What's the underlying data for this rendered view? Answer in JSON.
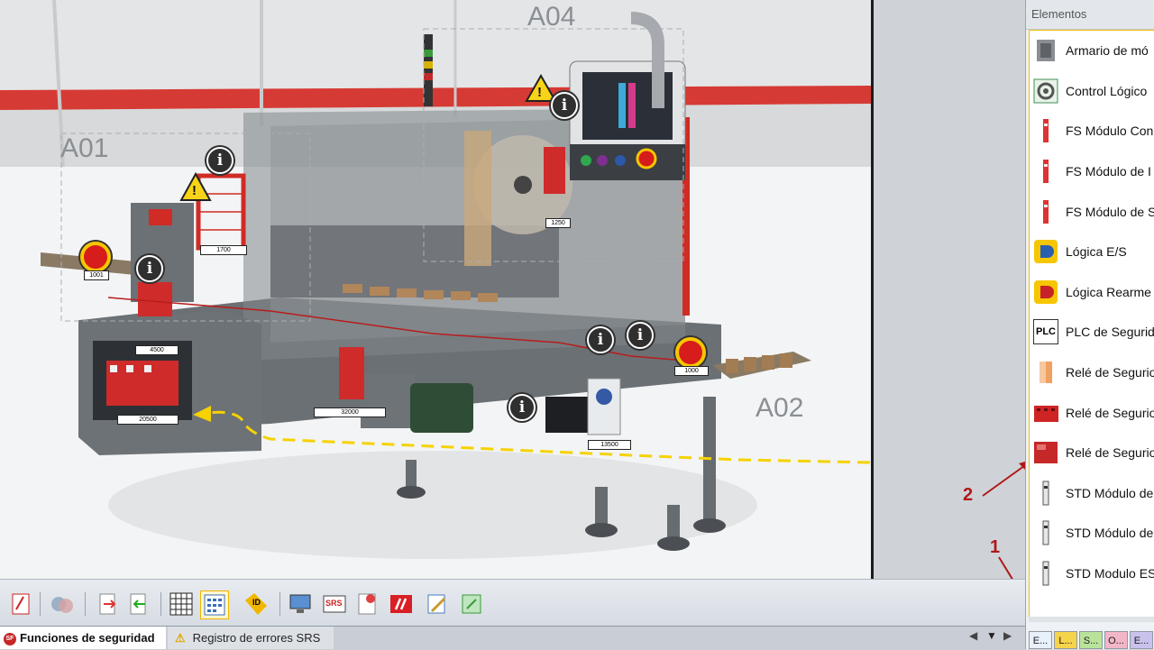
{
  "viewport": {
    "area_labels": {
      "a01": "A01",
      "a02": "A02",
      "a04": "A04"
    },
    "device_tags": {
      "t1001": "1001",
      "t1700": "1700",
      "t1250": "1250",
      "t4500": "4500",
      "t1000": "1000",
      "t20500": "20500",
      "t32000": "32000",
      "t13500": "13500"
    },
    "info_glyph": "i",
    "warning_glyph": "!"
  },
  "elements_panel": {
    "title": "Elementos",
    "items": [
      {
        "label": "Armario de mó",
        "icon": "cabinet-icon"
      },
      {
        "label": "Control Lógico",
        "icon": "gear-logic-icon"
      },
      {
        "label": "FS Módulo Con",
        "icon": "fs-module-icon"
      },
      {
        "label": "FS Módulo de I",
        "icon": "fs-module-icon"
      },
      {
        "label": "FS Módulo de S",
        "icon": "fs-module-icon"
      },
      {
        "label": "Lógica E/S",
        "icon": "logic-io-icon"
      },
      {
        "label": "Lógica Rearme",
        "icon": "logic-reset-icon"
      },
      {
        "label": "PLC de Segurid",
        "icon": "plc-icon"
      },
      {
        "label": "Relé de Segurio",
        "icon": "relay-orange-icon"
      },
      {
        "label": "Relé de Segurio",
        "icon": "relay-red-icon"
      },
      {
        "label": "Relé de Segurio",
        "icon": "relay-red-box-icon"
      },
      {
        "label": "STD Módulo de",
        "icon": "std-module-icon"
      },
      {
        "label": "STD Módulo de",
        "icon": "std-module-icon"
      },
      {
        "label": "STD Modulo ES",
        "icon": "std-module-icon"
      }
    ],
    "plc_icon_text": "PLC",
    "tabs": [
      {
        "label": "E...",
        "color": "#e8f0fb"
      },
      {
        "label": "L...",
        "color": "#f5d34a"
      },
      {
        "label": "S...",
        "color": "#b9e39a"
      },
      {
        "label": "O...",
        "color": "#f2b6c8"
      },
      {
        "label": "E...",
        "color": "#c9c2ec"
      }
    ]
  },
  "annotations": {
    "one": "1",
    "two": "2"
  },
  "toolbar": {
    "srs_label": "SRS",
    "id_label": "ID"
  },
  "bottom_tabs": {
    "funciones": "Funciones de seguridad",
    "registro": "Registro de errores SRS",
    "funciones_badge": "SF"
  },
  "colors": {
    "accent_yellow": "#f5d200",
    "annotation_red": "#b01818",
    "warning_yellow": "#f7d417"
  }
}
